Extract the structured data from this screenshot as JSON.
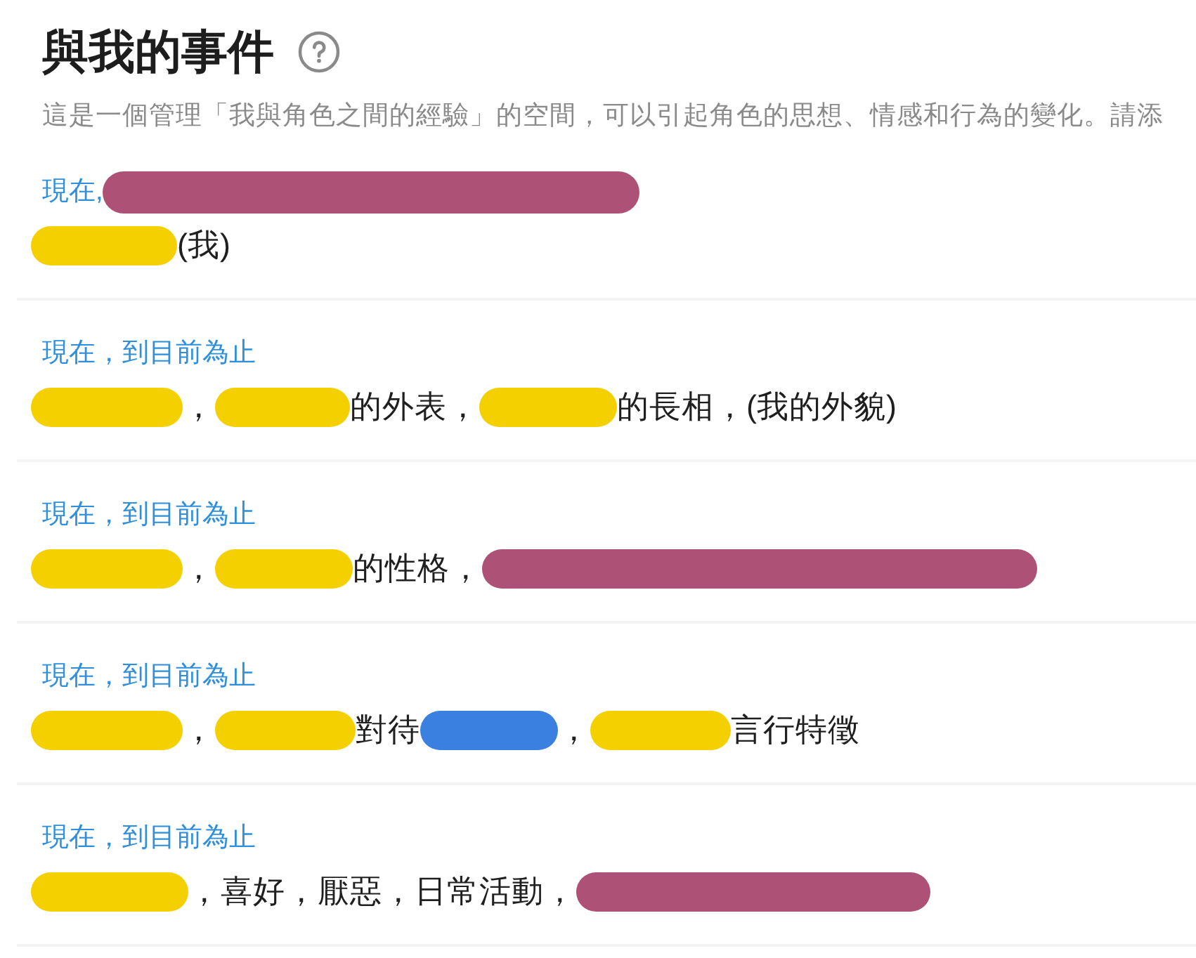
{
  "header": {
    "title": "與我的事件",
    "description": "這是一個管理「我與角色之間的經驗」的空間，可以引起角色的思想、情感和行為的變化。請添"
  },
  "events": [
    {
      "label": [
        {
          "kind": "text",
          "text": "現在,"
        },
        {
          "kind": "redacted",
          "color": "#ad5276"
        }
      ],
      "content": [
        {
          "kind": "redacted",
          "color": "#f5d000"
        },
        {
          "kind": "text",
          "text": "(我)"
        }
      ]
    },
    {
      "label": [
        {
          "kind": "text",
          "text": "現在，到目前為止"
        }
      ],
      "content": [
        {
          "kind": "redacted",
          "color": "#f5d000"
        },
        {
          "kind": "text",
          "text": "，"
        },
        {
          "kind": "redacted",
          "color": "#f5d000"
        },
        {
          "kind": "text",
          "text": "的外表，"
        },
        {
          "kind": "redacted",
          "color": "#f5d000"
        },
        {
          "kind": "text",
          "text": "的長相，(我的外貌)"
        }
      ]
    },
    {
      "label": [
        {
          "kind": "text",
          "text": "現在，到目前為止"
        }
      ],
      "content": [
        {
          "kind": "redacted",
          "color": "#f5d000"
        },
        {
          "kind": "text",
          "text": "，"
        },
        {
          "kind": "redacted",
          "color": "#f5d000"
        },
        {
          "kind": "text",
          "text": "的性格，"
        },
        {
          "kind": "redacted",
          "color": "#ad5276"
        }
      ]
    },
    {
      "label": [
        {
          "kind": "text",
          "text": "現在，到目前為止"
        }
      ],
      "content": [
        {
          "kind": "redacted",
          "color": "#f5d000"
        },
        {
          "kind": "text",
          "text": "，"
        },
        {
          "kind": "redacted",
          "color": "#f5d000"
        },
        {
          "kind": "text",
          "text": "對待"
        },
        {
          "kind": "redacted",
          "color": "#3a80e0"
        },
        {
          "kind": "text",
          "text": "，"
        },
        {
          "kind": "redacted",
          "color": "#f5d000"
        },
        {
          "kind": "text",
          "text": "言行特徵"
        }
      ]
    },
    {
      "label": [
        {
          "kind": "text",
          "text": "現在，到目前為止"
        }
      ],
      "content": [
        {
          "kind": "redacted",
          "color": "#f5d000"
        },
        {
          "kind": "text",
          "text": "，喜好，厭惡，日常活動，"
        },
        {
          "kind": "redacted",
          "color": "#ad5276"
        }
      ]
    }
  ]
}
